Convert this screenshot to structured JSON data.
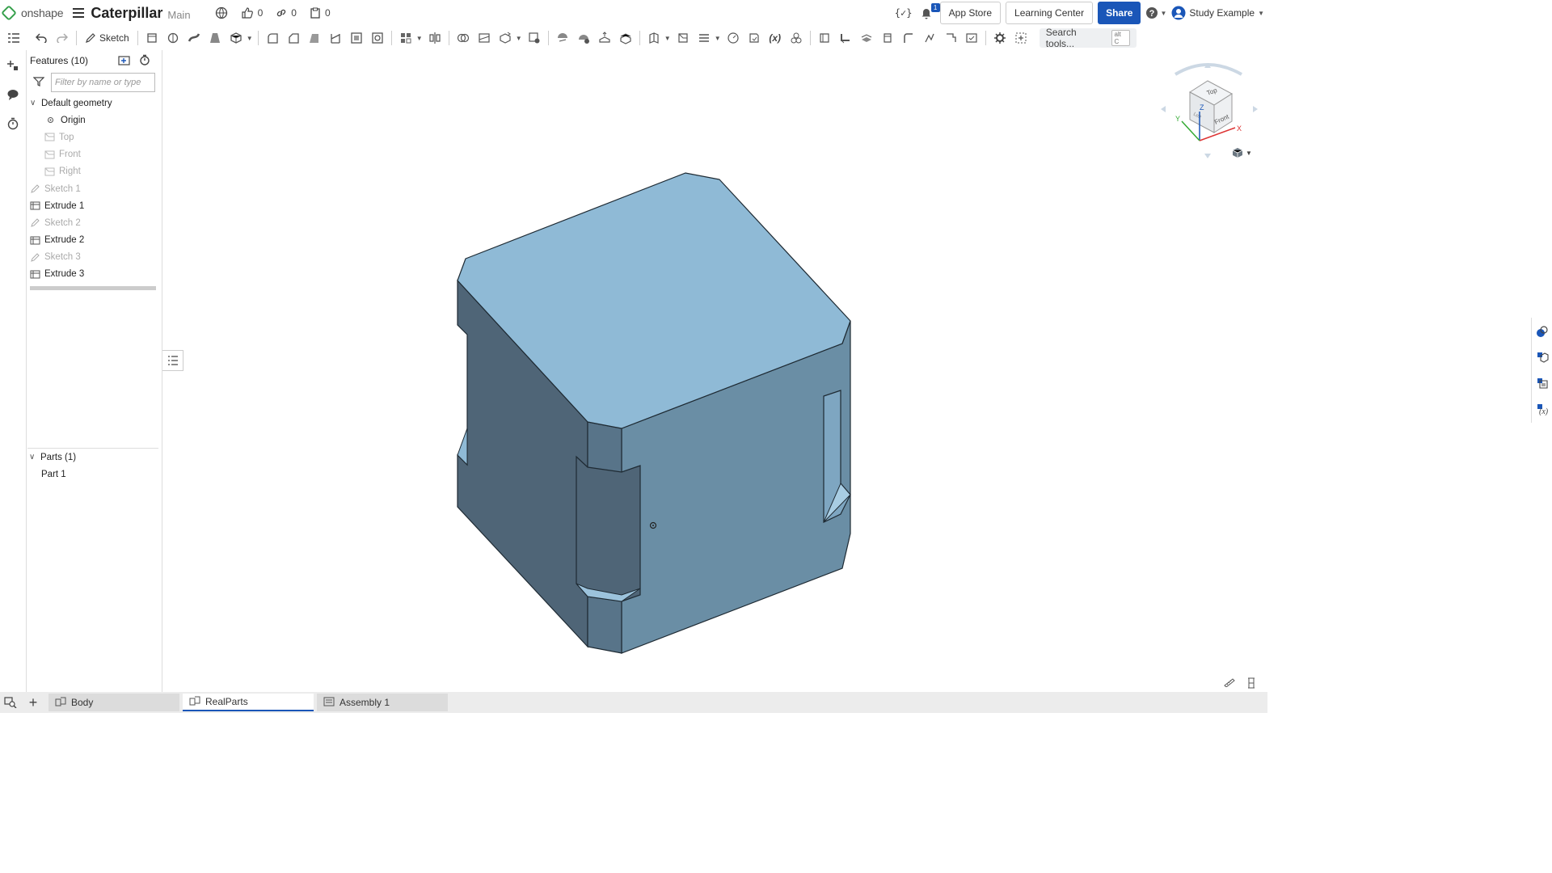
{
  "app": {
    "logo_text": "onshape",
    "doc_title": "Caterpillar",
    "branch": "Main"
  },
  "top_stats": {
    "likes": "0",
    "links": "0",
    "copies": "0"
  },
  "top_right": {
    "notifications_count": "1",
    "app_store": "App Store",
    "learning_center": "Learning Center",
    "share": "Share",
    "user_name": "Study Example"
  },
  "toolbar": {
    "sketch_label": "Sketch",
    "search_label": "Search tools...",
    "search_shortcut": "alt C"
  },
  "feature_panel": {
    "title": "Features (10)",
    "filter_placeholder": "Filter by name or type",
    "default_geometry": "Default geometry",
    "items": [
      {
        "label": "Origin",
        "dim": false
      },
      {
        "label": "Top",
        "dim": true
      },
      {
        "label": "Front",
        "dim": true
      },
      {
        "label": "Right",
        "dim": true
      }
    ],
    "features": [
      {
        "label": "Sketch 1",
        "kind": "sketch"
      },
      {
        "label": "Extrude 1",
        "kind": "extrude"
      },
      {
        "label": "Sketch 2",
        "kind": "sketch"
      },
      {
        "label": "Extrude 2",
        "kind": "extrude"
      },
      {
        "label": "Sketch 3",
        "kind": "sketch"
      },
      {
        "label": "Extrude 3",
        "kind": "extrude"
      }
    ],
    "parts_title": "Parts (1)",
    "parts": [
      "Part 1"
    ]
  },
  "view_cube": {
    "top": "Top",
    "front": "Front",
    "left": "Left",
    "axis_x": "X",
    "axis_y": "Y",
    "axis_z": "Z"
  },
  "model_colors": {
    "top": "#8fbad6",
    "left": "#4f6577",
    "right": "#6a8ea5",
    "edge": "#1e2a33"
  },
  "bottom_tabs": [
    {
      "label": "Body",
      "active": false
    },
    {
      "label": "RealParts",
      "active": true
    },
    {
      "label": "Assembly 1",
      "active": false
    }
  ]
}
